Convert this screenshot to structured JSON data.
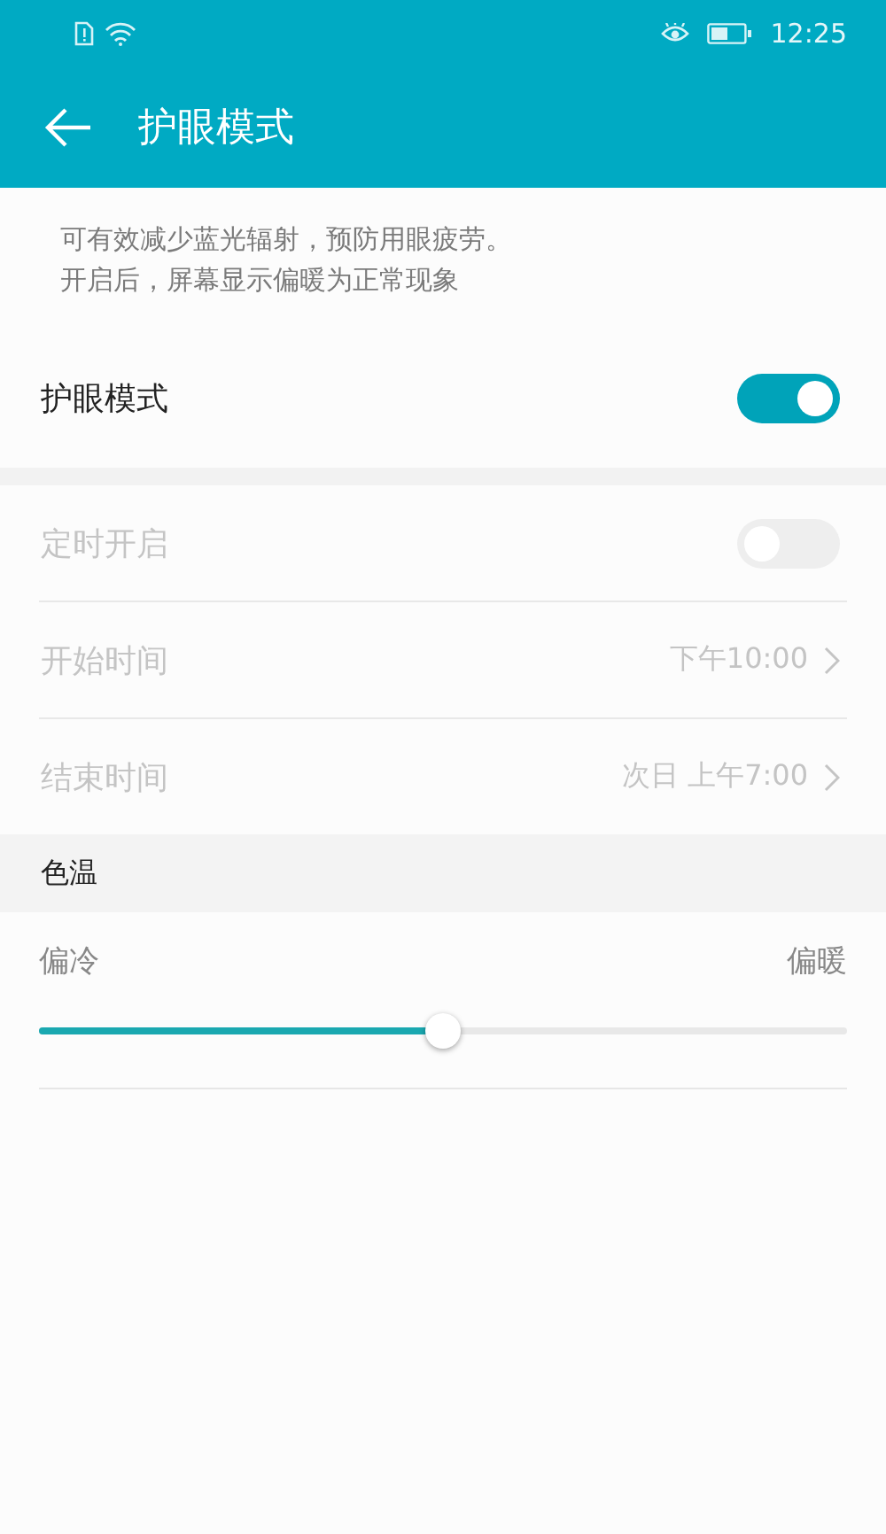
{
  "status_bar": {
    "time": "12:25"
  },
  "app_bar": {
    "title": "护眼模式"
  },
  "description": [
    "可有效减少蓝光辐射，预防用眼疲劳。",
    "开启后，屏幕显示偏暖为正常现象"
  ],
  "main_toggle": {
    "label": "护眼模式",
    "on": true
  },
  "schedule": [
    {
      "kind": "switch",
      "label": "定时开启",
      "on": false,
      "disabled": true
    },
    {
      "kind": "value",
      "label": "开始时间",
      "value": "下午10:00",
      "disabled": true
    },
    {
      "kind": "value",
      "label": "结束时间",
      "value": "次日 上午7:00",
      "disabled": true
    }
  ],
  "color_temperature": {
    "title": "色温",
    "min_label": "偏冷",
    "max_label": "偏暖",
    "level": 0.5
  }
}
